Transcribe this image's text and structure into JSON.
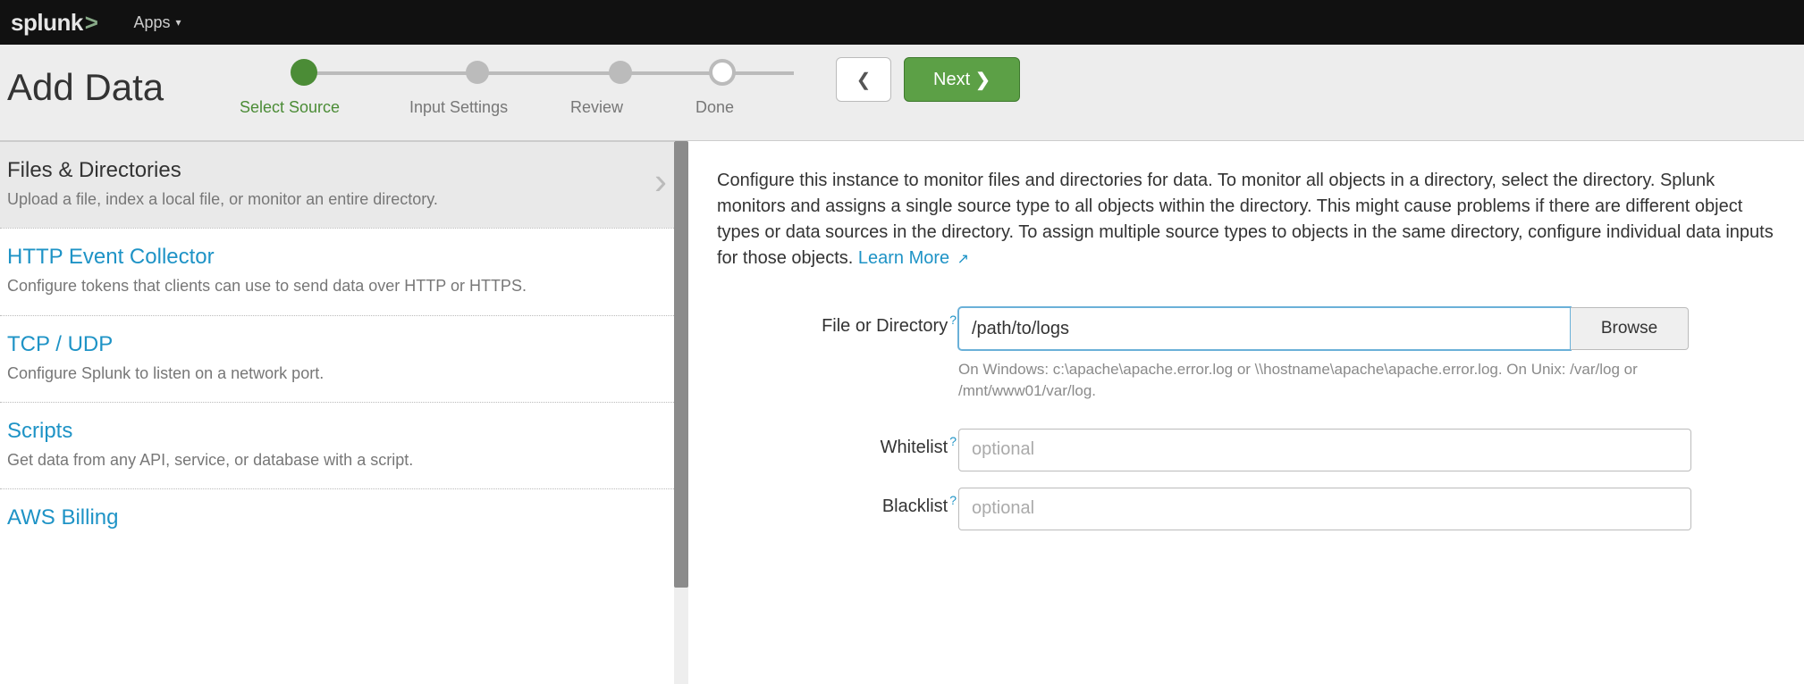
{
  "topbar": {
    "logo_text": "splunk",
    "apps_label": "Apps"
  },
  "header": {
    "title": "Add Data",
    "steps": [
      "Select Source",
      "Input Settings",
      "Review",
      "Done"
    ],
    "back_label": "",
    "next_label": "Next"
  },
  "sources": [
    {
      "title": "Files & Directories",
      "desc": "Upload a file, index a local file, or monitor an entire directory.",
      "selected": true
    },
    {
      "title": "HTTP Event Collector",
      "desc": "Configure tokens that clients can use to send data over HTTP or HTTPS."
    },
    {
      "title": "TCP / UDP",
      "desc": "Configure Splunk to listen on a network port."
    },
    {
      "title": "Scripts",
      "desc": "Get data from any API, service, or database with a script."
    },
    {
      "title": "AWS Billing",
      "desc": ""
    }
  ],
  "right": {
    "description": "Configure this instance to monitor files and directories for data. To monitor all objects in a directory, select the directory. Splunk monitors and assigns a single source type to all objects within the directory. This might cause problems if there are different object types or data sources in the directory. To assign multiple source types to objects in the same directory, configure individual data inputs for those objects. ",
    "learn_more": "Learn More",
    "fields": {
      "file_label": "File or Directory",
      "file_value": "/path/to/logs",
      "browse_label": "Browse",
      "file_hint": "On Windows: c:\\apache\\apache.error.log or \\\\hostname\\apache\\apache.error.log. On Unix: /var/log or /mnt/www01/var/log.",
      "whitelist_label": "Whitelist",
      "whitelist_placeholder": "optional",
      "blacklist_label": "Blacklist",
      "blacklist_placeholder": "optional"
    }
  }
}
